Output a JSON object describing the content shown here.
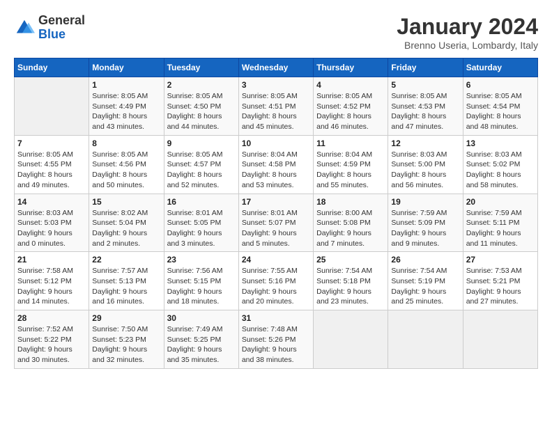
{
  "logo": {
    "general": "General",
    "blue": "Blue"
  },
  "header": {
    "month": "January 2024",
    "location": "Brenno Useria, Lombardy, Italy"
  },
  "weekdays": [
    "Sunday",
    "Monday",
    "Tuesday",
    "Wednesday",
    "Thursday",
    "Friday",
    "Saturday"
  ],
  "weeks": [
    [
      {
        "day": "",
        "info": ""
      },
      {
        "day": "1",
        "info": "Sunrise: 8:05 AM\nSunset: 4:49 PM\nDaylight: 8 hours\nand 43 minutes."
      },
      {
        "day": "2",
        "info": "Sunrise: 8:05 AM\nSunset: 4:50 PM\nDaylight: 8 hours\nand 44 minutes."
      },
      {
        "day": "3",
        "info": "Sunrise: 8:05 AM\nSunset: 4:51 PM\nDaylight: 8 hours\nand 45 minutes."
      },
      {
        "day": "4",
        "info": "Sunrise: 8:05 AM\nSunset: 4:52 PM\nDaylight: 8 hours\nand 46 minutes."
      },
      {
        "day": "5",
        "info": "Sunrise: 8:05 AM\nSunset: 4:53 PM\nDaylight: 8 hours\nand 47 minutes."
      },
      {
        "day": "6",
        "info": "Sunrise: 8:05 AM\nSunset: 4:54 PM\nDaylight: 8 hours\nand 48 minutes."
      }
    ],
    [
      {
        "day": "7",
        "info": "Sunrise: 8:05 AM\nSunset: 4:55 PM\nDaylight: 8 hours\nand 49 minutes."
      },
      {
        "day": "8",
        "info": "Sunrise: 8:05 AM\nSunset: 4:56 PM\nDaylight: 8 hours\nand 50 minutes."
      },
      {
        "day": "9",
        "info": "Sunrise: 8:05 AM\nSunset: 4:57 PM\nDaylight: 8 hours\nand 52 minutes."
      },
      {
        "day": "10",
        "info": "Sunrise: 8:04 AM\nSunset: 4:58 PM\nDaylight: 8 hours\nand 53 minutes."
      },
      {
        "day": "11",
        "info": "Sunrise: 8:04 AM\nSunset: 4:59 PM\nDaylight: 8 hours\nand 55 minutes."
      },
      {
        "day": "12",
        "info": "Sunrise: 8:03 AM\nSunset: 5:00 PM\nDaylight: 8 hours\nand 56 minutes."
      },
      {
        "day": "13",
        "info": "Sunrise: 8:03 AM\nSunset: 5:02 PM\nDaylight: 8 hours\nand 58 minutes."
      }
    ],
    [
      {
        "day": "14",
        "info": "Sunrise: 8:03 AM\nSunset: 5:03 PM\nDaylight: 9 hours\nand 0 minutes."
      },
      {
        "day": "15",
        "info": "Sunrise: 8:02 AM\nSunset: 5:04 PM\nDaylight: 9 hours\nand 2 minutes."
      },
      {
        "day": "16",
        "info": "Sunrise: 8:01 AM\nSunset: 5:05 PM\nDaylight: 9 hours\nand 3 minutes."
      },
      {
        "day": "17",
        "info": "Sunrise: 8:01 AM\nSunset: 5:07 PM\nDaylight: 9 hours\nand 5 minutes."
      },
      {
        "day": "18",
        "info": "Sunrise: 8:00 AM\nSunset: 5:08 PM\nDaylight: 9 hours\nand 7 minutes."
      },
      {
        "day": "19",
        "info": "Sunrise: 7:59 AM\nSunset: 5:09 PM\nDaylight: 9 hours\nand 9 minutes."
      },
      {
        "day": "20",
        "info": "Sunrise: 7:59 AM\nSunset: 5:11 PM\nDaylight: 9 hours\nand 11 minutes."
      }
    ],
    [
      {
        "day": "21",
        "info": "Sunrise: 7:58 AM\nSunset: 5:12 PM\nDaylight: 9 hours\nand 14 minutes."
      },
      {
        "day": "22",
        "info": "Sunrise: 7:57 AM\nSunset: 5:13 PM\nDaylight: 9 hours\nand 16 minutes."
      },
      {
        "day": "23",
        "info": "Sunrise: 7:56 AM\nSunset: 5:15 PM\nDaylight: 9 hours\nand 18 minutes."
      },
      {
        "day": "24",
        "info": "Sunrise: 7:55 AM\nSunset: 5:16 PM\nDaylight: 9 hours\nand 20 minutes."
      },
      {
        "day": "25",
        "info": "Sunrise: 7:54 AM\nSunset: 5:18 PM\nDaylight: 9 hours\nand 23 minutes."
      },
      {
        "day": "26",
        "info": "Sunrise: 7:54 AM\nSunset: 5:19 PM\nDaylight: 9 hours\nand 25 minutes."
      },
      {
        "day": "27",
        "info": "Sunrise: 7:53 AM\nSunset: 5:21 PM\nDaylight: 9 hours\nand 27 minutes."
      }
    ],
    [
      {
        "day": "28",
        "info": "Sunrise: 7:52 AM\nSunset: 5:22 PM\nDaylight: 9 hours\nand 30 minutes."
      },
      {
        "day": "29",
        "info": "Sunrise: 7:50 AM\nSunset: 5:23 PM\nDaylight: 9 hours\nand 32 minutes."
      },
      {
        "day": "30",
        "info": "Sunrise: 7:49 AM\nSunset: 5:25 PM\nDaylight: 9 hours\nand 35 minutes."
      },
      {
        "day": "31",
        "info": "Sunrise: 7:48 AM\nSunset: 5:26 PM\nDaylight: 9 hours\nand 38 minutes."
      },
      {
        "day": "",
        "info": ""
      },
      {
        "day": "",
        "info": ""
      },
      {
        "day": "",
        "info": ""
      }
    ]
  ]
}
